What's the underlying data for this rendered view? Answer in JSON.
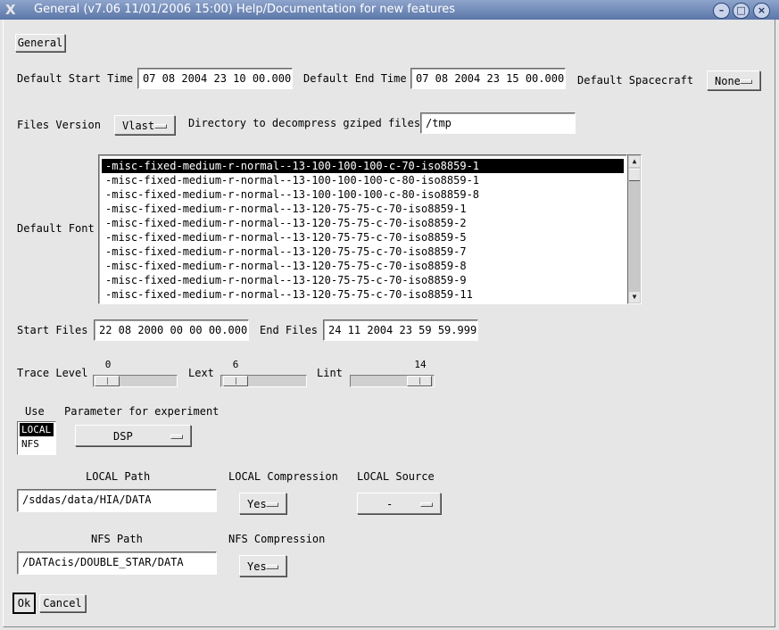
{
  "window": {
    "title": "General (v7.06 11/01/2006 15:00)  Help/Documentation for new features",
    "logo": "X",
    "controls": {
      "minimize": "–",
      "maximize": "□",
      "close": "×"
    }
  },
  "general_button": "General",
  "row1": {
    "start_label": "Default Start Time",
    "start_value": "07 08 2004 23 10 00.000",
    "end_label": "Default End Time",
    "end_value": "07 08 2004 23 15 00.000",
    "spacecraft_label": "Default Spacecraft",
    "spacecraft_value": "None"
  },
  "row2": {
    "version_label": "Files Version",
    "version_value": "Vlast",
    "dir_label": "Directory to decompress gziped files",
    "dir_value": "/tmp"
  },
  "font": {
    "label": "Default Font",
    "items": [
      "-misc-fixed-medium-r-normal--13-100-100-100-c-70-iso8859-1",
      "-misc-fixed-medium-r-normal--13-100-100-100-c-80-iso8859-1",
      "-misc-fixed-medium-r-normal--13-100-100-100-c-80-iso8859-8",
      "-misc-fixed-medium-r-normal--13-120-75-75-c-70-iso8859-1",
      "-misc-fixed-medium-r-normal--13-120-75-75-c-70-iso8859-2",
      "-misc-fixed-medium-r-normal--13-120-75-75-c-70-iso8859-5",
      "-misc-fixed-medium-r-normal--13-120-75-75-c-70-iso8859-7",
      "-misc-fixed-medium-r-normal--13-120-75-75-c-70-iso8859-8",
      "-misc-fixed-medium-r-normal--13-120-75-75-c-70-iso8859-9",
      "-misc-fixed-medium-r-normal--13-120-75-75-c-70-iso8859-11"
    ],
    "selected_index": 0
  },
  "files": {
    "start_label": "Start Files",
    "start_value": "22 08 2000 00 00 00.000",
    "end_label": "End Files",
    "end_value": "24 11 2004 23 59 59.999"
  },
  "levels": {
    "trace_label": "Trace Level",
    "trace_value": "0",
    "lext_label": "Lext",
    "lext_value": "6",
    "lint_label": "Lint",
    "lint_value": "14"
  },
  "use": {
    "label": "Use",
    "options": [
      "LOCAL",
      "NFS"
    ],
    "selected": "LOCAL",
    "param_label": "Parameter for experiment",
    "param_value": "DSP"
  },
  "local": {
    "path_label": "LOCAL Path",
    "path_value": "/sddas/data/HIA/DATA",
    "compression_label": "LOCAL Compression",
    "compression_value": "Yes",
    "source_label": "LOCAL Source",
    "source_value": "-"
  },
  "nfs": {
    "path_label": "NFS Path",
    "path_value": "/DATAcis/DOUBLE_STAR/DATA",
    "compression_label": "NFS Compression",
    "compression_value": "Yes"
  },
  "footer": {
    "ok": "Ok",
    "cancel": "Cancel"
  }
}
